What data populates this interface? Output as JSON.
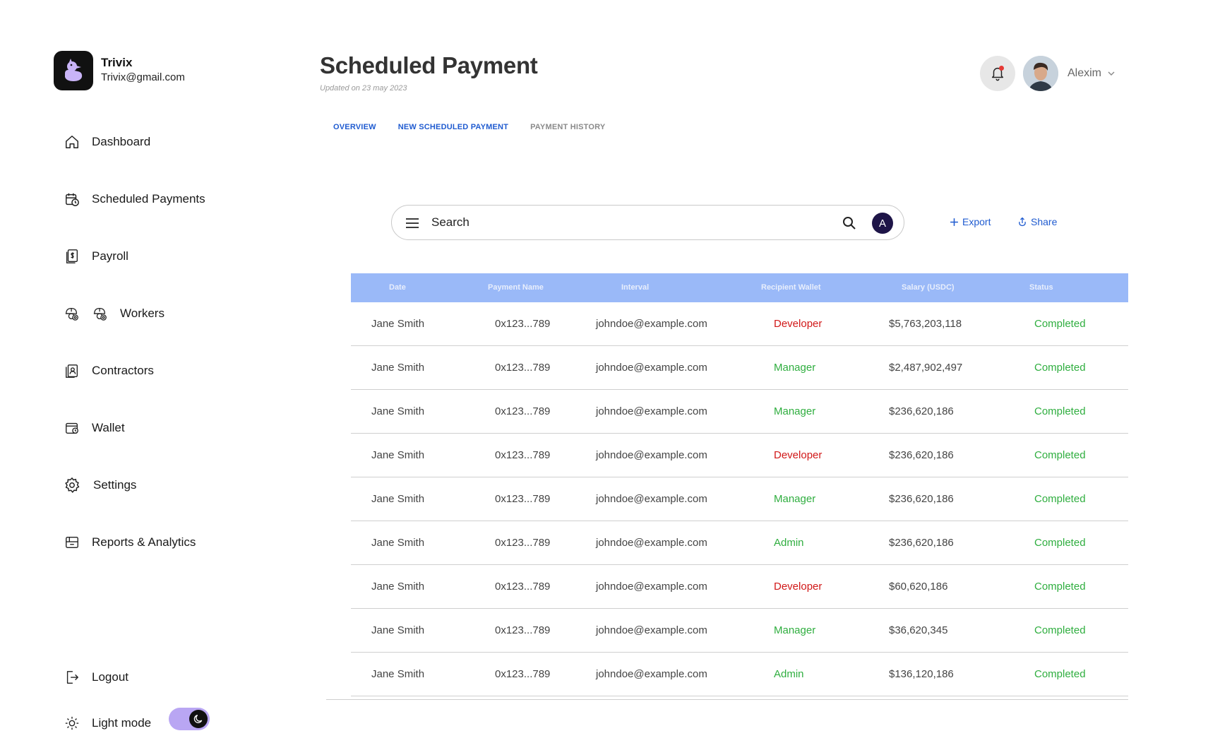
{
  "brand": {
    "name": "Trivix",
    "email": "Trivix@gmail.com"
  },
  "sidebar": {
    "items": [
      {
        "label": "Dashboard",
        "icon": "home-icon"
      },
      {
        "label": "Scheduled Payments",
        "icon": "calendar-clock-icon"
      },
      {
        "label": "Payroll",
        "icon": "payroll-icon"
      },
      {
        "label": "Workers",
        "icon": "workers-icon"
      },
      {
        "label": "Contractors",
        "icon": "contractors-icon"
      },
      {
        "label": "Wallet",
        "icon": "wallet-icon"
      },
      {
        "label": "Settings",
        "icon": "gear-icon"
      },
      {
        "label": "Reports & Analytics",
        "icon": "reports-icon"
      }
    ],
    "logout_label": "Logout",
    "theme_label": "Light mode"
  },
  "header": {
    "title": "Scheduled Payment",
    "updated": "Updated on 23 may 2023",
    "user_name": "Alexim"
  },
  "tabs": [
    {
      "label": "OVERVIEW",
      "active": true
    },
    {
      "label": "NEW SCHEDULED PAYMENT",
      "active": true
    },
    {
      "label": "PAYMENT HISTORY",
      "active": false
    }
  ],
  "search": {
    "placeholder": "Search",
    "avatar_letter": "A"
  },
  "actions": {
    "export_label": "Export",
    "share_label": "Share"
  },
  "table": {
    "columns": [
      "Date",
      "Payment Name",
      "Interval",
      "Recipient Wallet",
      "Salary (USDC)",
      "Status"
    ],
    "rows": [
      [
        "Jane Smith",
        "0x123...789",
        "johndoe@example.com",
        "Developer",
        "$5,763,203,118",
        "Completed"
      ],
      [
        "Jane Smith",
        "0x123...789",
        "johndoe@example.com",
        "Manager",
        "$2,487,902,497",
        "Completed"
      ],
      [
        "Jane Smith",
        "0x123...789",
        "johndoe@example.com",
        "Manager",
        "$236,620,186",
        "Completed"
      ],
      [
        "Jane Smith",
        "0x123...789",
        "johndoe@example.com",
        "Developer",
        "$236,620,186",
        "Completed"
      ],
      [
        "Jane Smith",
        "0x123...789",
        "johndoe@example.com",
        "Manager",
        "$236,620,186",
        "Completed"
      ],
      [
        "Jane Smith",
        "0x123...789",
        "johndoe@example.com",
        "Admin",
        "$236,620,186",
        "Completed"
      ],
      [
        "Jane Smith",
        "0x123...789",
        "johndoe@example.com",
        "Developer",
        "$60,620,186",
        "Completed"
      ],
      [
        "Jane Smith",
        "0x123...789",
        "johndoe@example.com",
        "Manager",
        "$36,620,345",
        "Completed"
      ],
      [
        "Jane Smith",
        "0x123...789",
        "johndoe@example.com",
        "Admin",
        "$136,120,186",
        "Completed"
      ]
    ]
  },
  "colors": {
    "accent": "#1f5bd0",
    "table_header": "#9ab9f8",
    "developer": "#d11818",
    "manager_admin": "#2fae3f",
    "status_completed": "#2fae3f",
    "toggle": "#b9a6f3"
  }
}
